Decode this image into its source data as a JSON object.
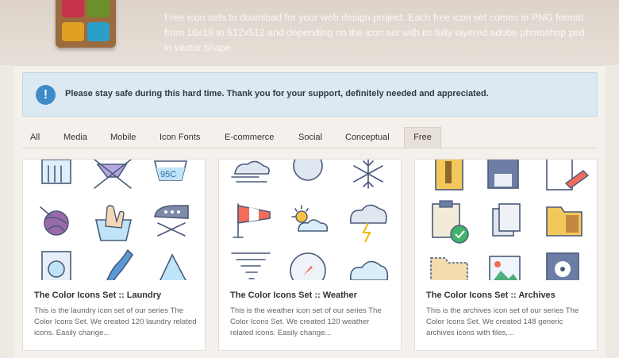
{
  "hero": {
    "description": "Free icon sets to download for your web design project. Each free icon set comes in PNG format from 16x16 to 512x512 and depending on the icon set with its fully layered adobe photoshop psd in vector shape."
  },
  "notice": {
    "icon": "info-icon",
    "text": "Please stay safe during this hard time. Thank you for your support, definitely needed and appreciated."
  },
  "tabs": [
    {
      "label": "All"
    },
    {
      "label": "Media"
    },
    {
      "label": "Mobile"
    },
    {
      "label": "Icon Fonts"
    },
    {
      "label": "E-commerce"
    },
    {
      "label": "Social"
    },
    {
      "label": "Conceptual"
    },
    {
      "label": "Free",
      "active": true
    }
  ],
  "cards": [
    {
      "title": "The Color Icons Set :: Laundry",
      "description": "This is the laundry icon set of our series The Color Icons Set. We created 120 laundry related icons. Easily change...",
      "icons": [
        "do-not-dry-clean-icon",
        "no-wring-icon",
        "wash-95c-icon",
        "yarn-ball-icon",
        "hand-wash-icon",
        "ironing-icon",
        "washing-machine-icon",
        "twisted-cloth-icon",
        "triangle-bleach-icon"
      ],
      "wash_label": "95C"
    },
    {
      "title": "The Color Icons Set :: Weather",
      "description": "This is the weather icon set of our series The Color Icons Set. We created 120 weather related icons. Easily change...",
      "icons": [
        "wind-cloud-icon",
        "moon-icon",
        "snowflake-icon",
        "windsock-icon",
        "sun-cloud-icon",
        "thunderstorm-icon",
        "tornado-icon",
        "compass-icon",
        "clouds-icon"
      ]
    },
    {
      "title": "The Color Icons Set :: Archives",
      "description": "This is the archives icon set of our series The Color Icons Set. We created 148 generic archives icons with files,...",
      "icons": [
        "zip-file-icon",
        "floppy-save-icon",
        "notepad-edit-icon",
        "clipboard-check-icon",
        "documents-icon",
        "folder-icon",
        "open-folder-icon",
        "image-file-icon",
        "disk-drive-icon"
      ]
    }
  ],
  "colors": {
    "page_bg": "#efe9e3",
    "notice_bg": "#dde9f2",
    "notice_icon": "#3d8bc9",
    "icon_stroke": "#4a5a7a"
  }
}
